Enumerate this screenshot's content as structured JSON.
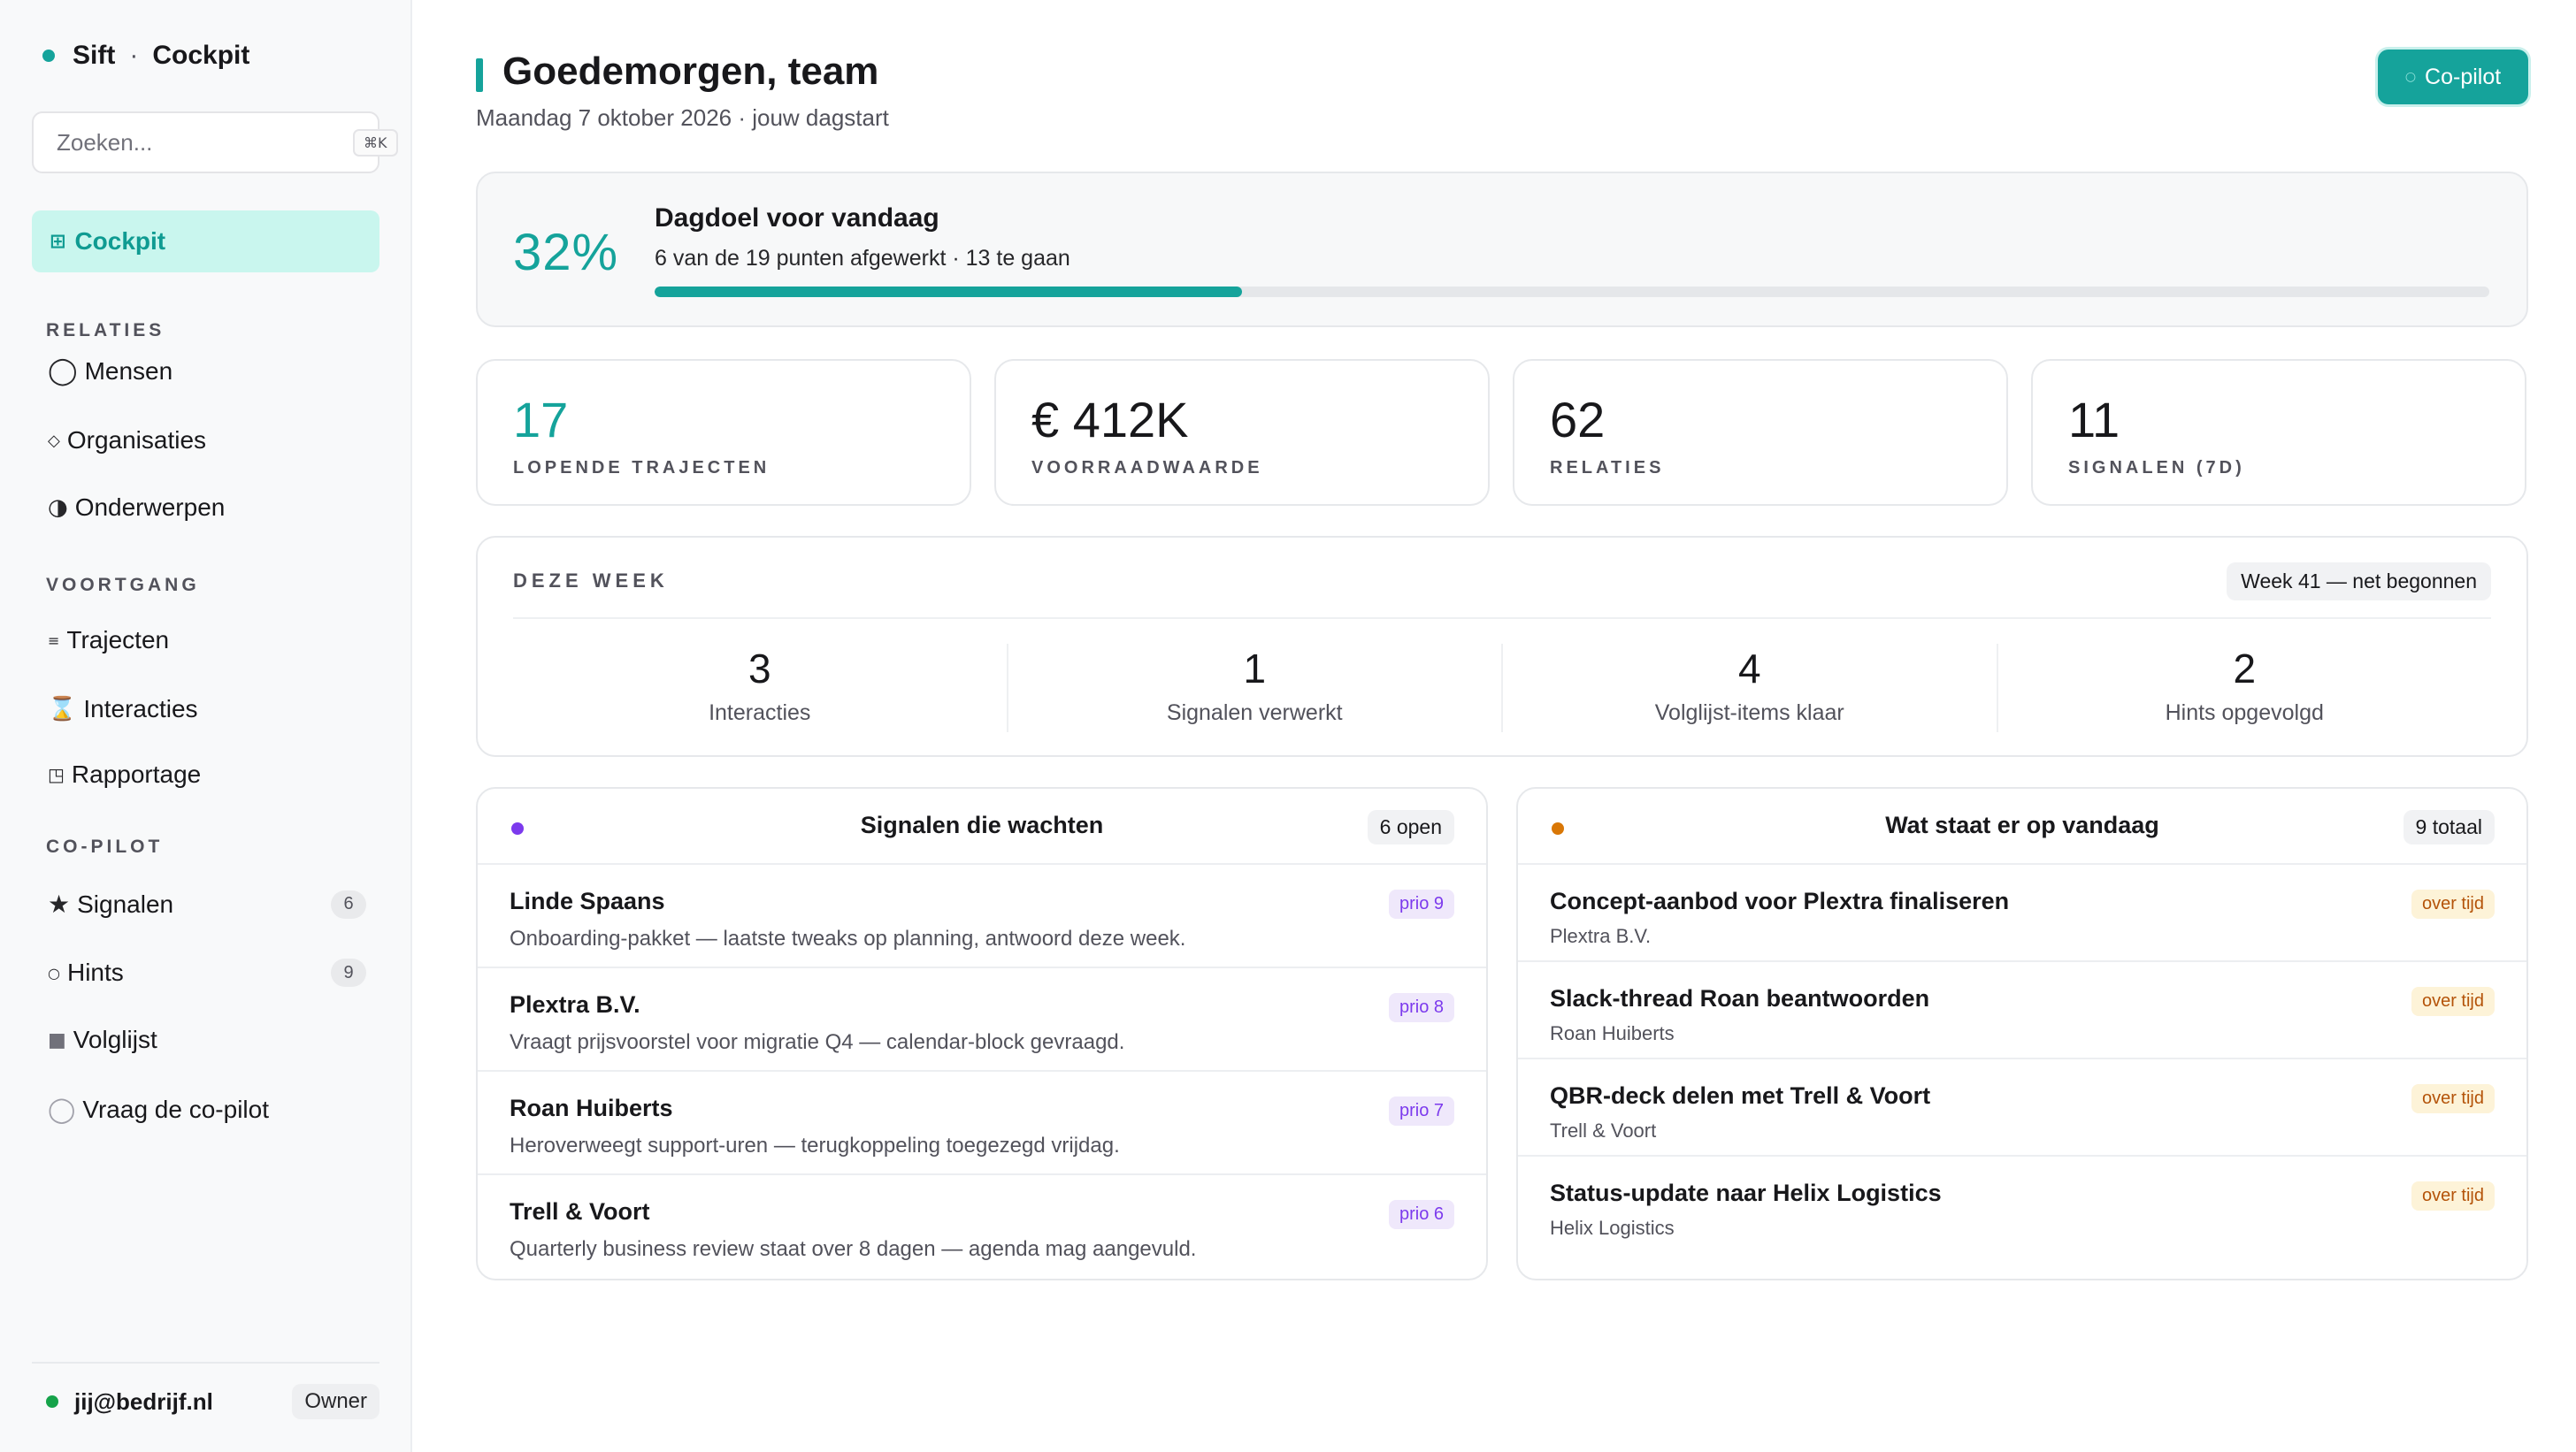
{
  "sidebar": {
    "brand": "Sift",
    "brand_separator": "·",
    "brand_section": "Cockpit",
    "search_placeholder": "Zoeken...",
    "search_shortcut": "⌘K",
    "active_item": {
      "icon": "grid-icon",
      "label": "Cockpit"
    },
    "sections": [
      {
        "title": "RELATIES",
        "items": [
          {
            "icon": "circle-icon",
            "label": "Mensen"
          },
          {
            "icon": "diamond-icon",
            "label": "Organisaties"
          },
          {
            "icon": "half-circle-icon",
            "label": "Onderwerpen"
          }
        ]
      },
      {
        "title": "VOORTGANG",
        "items": [
          {
            "icon": "list-icon",
            "label": "Trajecten"
          },
          {
            "icon": "hourglass-icon",
            "label": "Interacties"
          },
          {
            "icon": "report-icon",
            "label": "Rapportage"
          }
        ]
      },
      {
        "title": "CO-PILOT",
        "items": [
          {
            "icon": "star-icon",
            "label": "Signalen",
            "count": "6"
          },
          {
            "icon": "small-circle-icon",
            "label": "Hints",
            "count": "9"
          },
          {
            "icon": "square-icon",
            "label": "Volglijst"
          },
          {
            "icon": "circle-outline-icon",
            "label": "Vraag de co-pilot"
          }
        ]
      }
    ],
    "user": {
      "email": "jij@bedrijf.nl",
      "role": "Owner",
      "status_color": "#16a34a"
    }
  },
  "header": {
    "title": "Goedemorgen, team",
    "subtitle": "Maandag 7 oktober 2026 · jouw dagstart",
    "copilot_button": "Co-pilot"
  },
  "goal": {
    "percent_label": "32%",
    "percent_value": 32,
    "title": "Dagdoel voor vandaag",
    "subtitle": "6 van de 19 punten afgewerkt · 13 te gaan"
  },
  "stats": [
    {
      "value": "17",
      "label": "LOPENDE TRAJECTEN",
      "accent": true
    },
    {
      "value": "€ 412K",
      "label": "VOORRAADWAARDE",
      "accent": false
    },
    {
      "value": "62",
      "label": "RELATIES",
      "accent": false
    },
    {
      "value": "11",
      "label": "SIGNALEN (7D)",
      "accent": false
    }
  ],
  "week": {
    "title": "DEZE WEEK",
    "badge": "Week 41 — net begonnen",
    "items": [
      {
        "value": "3",
        "label": "Interacties"
      },
      {
        "value": "1",
        "label": "Signalen verwerkt"
      },
      {
        "value": "4",
        "label": "Volglijst-items klaar"
      },
      {
        "value": "2",
        "label": "Hints opgevolgd"
      }
    ]
  },
  "signals": {
    "title": "Signalen die wachten",
    "count": "6 open",
    "dot_color": "#7c3aed",
    "rows": [
      {
        "name": "Linde Spaans",
        "detail": "Onboarding-pakket — laatste tweaks op planning, antwoord deze week.",
        "tag": "prio 9"
      },
      {
        "name": "Plextra B.V.",
        "detail": "Vraagt prijsvoorstel voor migratie Q4 — calendar-block gevraagd.",
        "tag": "prio 8"
      },
      {
        "name": "Roan Huiberts",
        "detail": "Heroverweegt support-uren — terugkoppeling toegezegd vrijdag.",
        "tag": "prio 7"
      },
      {
        "name": "Trell & Voort",
        "detail": "Quarterly business review staat over 8 dagen — agenda mag aangevuld.",
        "tag": "prio 6"
      }
    ]
  },
  "today": {
    "title": "Wat staat er op vandaag",
    "count": "9 totaal",
    "dot_color": "#d97706",
    "rows": [
      {
        "name": "Concept-aanbod voor Plextra finaliseren",
        "detail": "Plextra B.V.",
        "tag": "over tijd"
      },
      {
        "name": "Slack-thread Roan beantwoorden",
        "detail": "Roan Huiberts",
        "tag": "over tijd"
      },
      {
        "name": "QBR-deck delen met Trell & Voort",
        "detail": "Trell & Voort",
        "tag": "over tijd"
      },
      {
        "name": "Status-update naar Helix Logistics",
        "detail": "Helix Logistics",
        "tag": "over tijd"
      }
    ]
  },
  "colors": {
    "accent": "#15a39b",
    "active_bg": "#c9f6ee",
    "prio_tag": "#7c3aed",
    "late_tag": "#b45309"
  }
}
